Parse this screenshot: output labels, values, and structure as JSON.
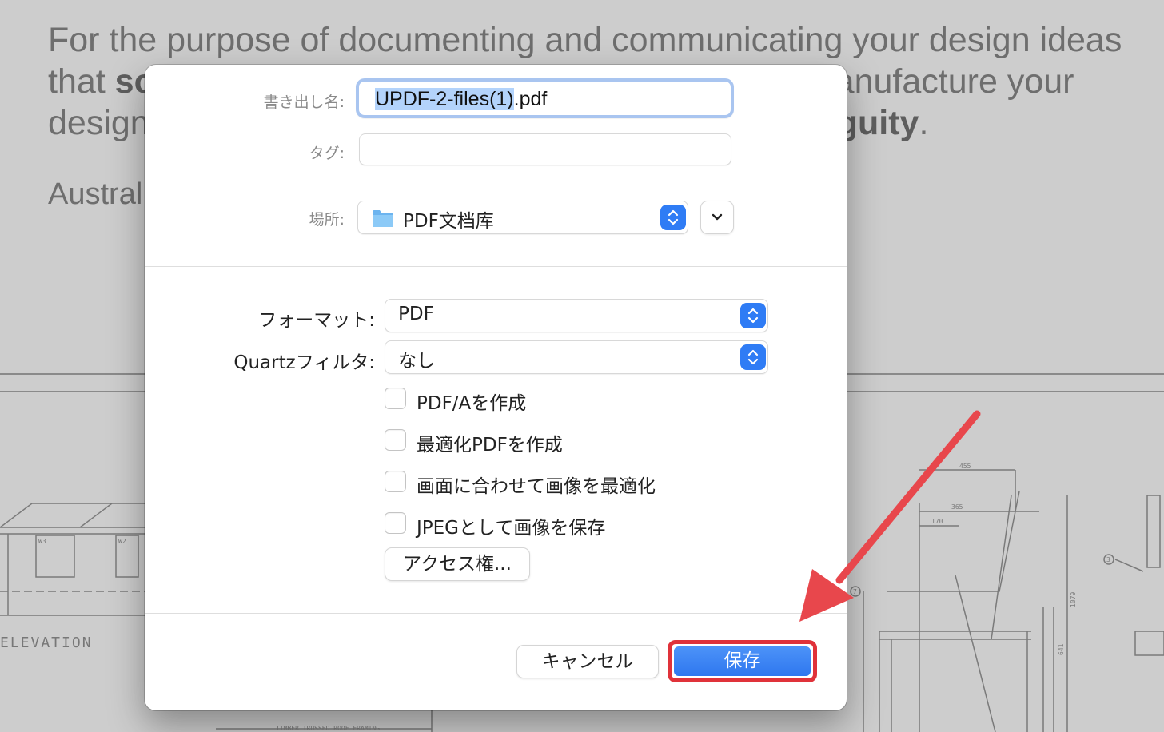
{
  "background": {
    "line1": "For the purpose of documenting and communicating your design ideas",
    "line2_start": "that ",
    "line2_bold": "so",
    "line2_end": "manufacture your",
    "line3_start": "design",
    "line3_bold": "guity",
    "line3_end": ".",
    "australia": "Austral",
    "elevation": "ELEVATION",
    "w3": "W3",
    "w2": "W2",
    "dim_455": "455",
    "dim_365": "365",
    "dim_170": "170",
    "dim_1079": "1079",
    "dim_641": "641",
    "callout_3": "3",
    "callout_7": "7",
    "roof_label": "TIMBER TRUSSED ROOF FRAMING"
  },
  "dialog": {
    "export_label": "書き出し名:",
    "filename_selected": "UPDF-2-files(1)",
    "filename_ext": ".pdf",
    "tag_label": "タグ:",
    "tag_value": "",
    "location_label": "場所:",
    "location_value": "PDF文档库",
    "format_label": "フォーマット:",
    "format_value": "PDF",
    "quartz_label": "Quartzフィルタ:",
    "quartz_value": "なし",
    "checkboxes": [
      {
        "label": "PDF/Aを作成",
        "checked": false
      },
      {
        "label": "最適化PDFを作成",
        "checked": false
      },
      {
        "label": "画面に合わせて画像を最適化",
        "checked": false
      },
      {
        "label": "JPEGとして画像を保存",
        "checked": false
      }
    ],
    "access_button": "アクセス権...",
    "cancel_button": "キャンセル",
    "save_button": "保存"
  },
  "colors": {
    "accent": "#2f7cf5",
    "highlight": "#e0323a",
    "selection": "#b3d3fb"
  },
  "icons": {
    "folder": "folder-icon",
    "stepper": "up-down-chevron-icon",
    "expand": "chevron-down-icon",
    "annotation": "red-arrow-icon"
  }
}
